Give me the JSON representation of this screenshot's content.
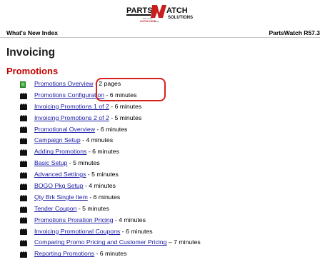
{
  "logo": {
    "text_top_left": "PARTS",
    "text_top_right": "ATCH",
    "text_bottom": "SOLUTIONS",
    "tagline_small": "Part of the",
    "tagline_brand": "AUTOLOGUE",
    "tagline_family": "family"
  },
  "header": {
    "left": "What's New Index",
    "right": "PartsWatch R57.3"
  },
  "section_title": "Invoicing",
  "subsection_title": "Promotions",
  "colors": {
    "link": "#1a1aa6",
    "subsection": "#c40000",
    "annotation": "#d8201e",
    "doc_icon": "#39a935"
  },
  "items": [
    {
      "icon": "document-icon",
      "link": "Promotions Overview",
      "duration": " - 2 pages"
    },
    {
      "icon": "video-icon",
      "link": "Promotions Configuration",
      "duration": " - 6 minutes"
    },
    {
      "icon": "video-icon",
      "link": "Invoicing Promotions 1 of 2",
      "duration": " - 6 minutes"
    },
    {
      "icon": "video-icon",
      "link": "Invoicing Promotions 2 of 2",
      "duration": " - 5 minutes"
    },
    {
      "icon": "video-icon",
      "link": "Promotional Overview",
      "duration": " - 6 minutes"
    },
    {
      "icon": "video-icon",
      "link": "Campaign Setup",
      "duration": " - 4 minutes"
    },
    {
      "icon": "video-icon",
      "link": "Adding Promotions",
      "duration": " - 6 minutes"
    },
    {
      "icon": "video-icon",
      "link": "Basic Setup",
      "duration": " - 5 minutes"
    },
    {
      "icon": "video-icon",
      "link": "Advanced Settings",
      "duration": " - 5 minutes"
    },
    {
      "icon": "video-icon",
      "link": "BOGO Pkg Setup",
      "duration": " - 4 minutes"
    },
    {
      "icon": "video-icon",
      "link": "Qty Brk Single Item",
      "duration": " - 6 minutes"
    },
    {
      "icon": "video-icon",
      "link": "Tender Coupon",
      "duration": " - 5 minutes"
    },
    {
      "icon": "video-icon",
      "link": "Promotions Proration Pricing",
      "duration": " - 4 minutes"
    },
    {
      "icon": "video-icon",
      "link": "Invoicing Promotional Coupons",
      "duration": " - 6 minutes"
    },
    {
      "icon": "video-icon",
      "link": "Comparing Promo Pricing and Customer Pricing",
      "duration": " – 7 minutes"
    },
    {
      "icon": "video-icon",
      "link": "Reporting Promotions",
      "duration": " - 6 minutes"
    }
  ]
}
